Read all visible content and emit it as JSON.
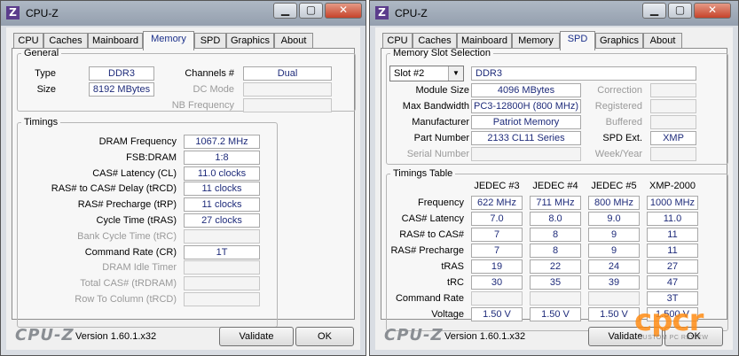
{
  "left": {
    "title": "CPU-Z",
    "tabs": [
      "CPU",
      "Caches",
      "Mainboard",
      "Memory",
      "SPD",
      "Graphics",
      "About"
    ],
    "active_tab": "Memory",
    "general": {
      "legend": "General",
      "type_label": "Type",
      "type_value": "DDR3",
      "size_label": "Size",
      "size_value": "8192 MBytes",
      "channels_label": "Channels #",
      "channels_value": "Dual",
      "dcmode_label": "DC Mode",
      "dcmode_value": "",
      "nbfreq_label": "NB Frequency",
      "nbfreq_value": ""
    },
    "timings": {
      "legend": "Timings",
      "rows": [
        {
          "label": "DRAM Frequency",
          "value": "1067.2 MHz",
          "dim": false
        },
        {
          "label": "FSB:DRAM",
          "value": "1:8",
          "dim": false
        },
        {
          "label": "CAS# Latency (CL)",
          "value": "11.0 clocks",
          "dim": false
        },
        {
          "label": "RAS# to CAS# Delay (tRCD)",
          "value": "11 clocks",
          "dim": false
        },
        {
          "label": "RAS# Precharge (tRP)",
          "value": "11 clocks",
          "dim": false
        },
        {
          "label": "Cycle Time (tRAS)",
          "value": "27 clocks",
          "dim": false
        },
        {
          "label": "Bank Cycle Time (tRC)",
          "value": "",
          "dim": true
        },
        {
          "label": "Command Rate (CR)",
          "value": "1T",
          "dim": false
        },
        {
          "label": "DRAM Idle Timer",
          "value": "",
          "dim": true
        },
        {
          "label": "Total CAS# (tRDRAM)",
          "value": "",
          "dim": true
        },
        {
          "label": "Row To Column (tRCD)",
          "value": "",
          "dim": true
        }
      ]
    },
    "footer": {
      "brand": "CPU-Z",
      "version": "Version 1.60.1.x32",
      "validate": "Validate",
      "ok": "OK"
    }
  },
  "right": {
    "title": "CPU-Z",
    "tabs": [
      "CPU",
      "Caches",
      "Mainboard",
      "Memory",
      "SPD",
      "Graphics",
      "About"
    ],
    "active_tab": "SPD",
    "slot": {
      "legend": "Memory Slot Selection",
      "selected": "Slot #2",
      "type": "DDR3",
      "module_size_label": "Module Size",
      "module_size": "4096 MBytes",
      "max_bw_label": "Max Bandwidth",
      "max_bw": "PC3-12800H (800 MHz)",
      "manufacturer_label": "Manufacturer",
      "manufacturer": "Patriot Memory",
      "part_label": "Part Number",
      "part": "2133 CL11 Series",
      "serial_label": "Serial Number",
      "serial": "",
      "correction_label": "Correction",
      "correction": "",
      "registered_label": "Registered",
      "registered": "",
      "buffered_label": "Buffered",
      "buffered": "",
      "spdext_label": "SPD Ext.",
      "spdext": "XMP",
      "week_label": "Week/Year",
      "week": ""
    },
    "timings_table": {
      "legend": "Timings Table",
      "columns": [
        "JEDEC #3",
        "JEDEC #4",
        "JEDEC #5",
        "XMP-2000"
      ],
      "rows": [
        {
          "label": "Frequency",
          "values": [
            "622 MHz",
            "711 MHz",
            "800 MHz",
            "1000 MHz"
          ]
        },
        {
          "label": "CAS# Latency",
          "values": [
            "7.0",
            "8.0",
            "9.0",
            "11.0"
          ]
        },
        {
          "label": "RAS# to CAS#",
          "values": [
            "7",
            "8",
            "9",
            "11"
          ]
        },
        {
          "label": "RAS# Precharge",
          "values": [
            "7",
            "8",
            "9",
            "11"
          ]
        },
        {
          "label": "tRAS",
          "values": [
            "19",
            "22",
            "24",
            "27"
          ]
        },
        {
          "label": "tRC",
          "values": [
            "30",
            "35",
            "39",
            "47"
          ]
        },
        {
          "label": "Command Rate",
          "values": [
            "",
            "",
            "",
            "3T"
          ]
        },
        {
          "label": "Voltage",
          "values": [
            "1.50 V",
            "1.50 V",
            "1.50 V",
            "1.500 V"
          ]
        }
      ]
    },
    "footer": {
      "brand": "CPU-Z",
      "version": "Version 1.60.1.x32",
      "validate": "Validate",
      "ok": "OK"
    }
  },
  "watermark": {
    "logo": "cpcr",
    "sub": "CUSTOM PC REVIEW"
  },
  "colors": {
    "value_text": "#1e2b7a",
    "active_tab_text": "#1a2f8a",
    "close_button": "#c6432b",
    "app_icon": "#5b3d8c"
  }
}
